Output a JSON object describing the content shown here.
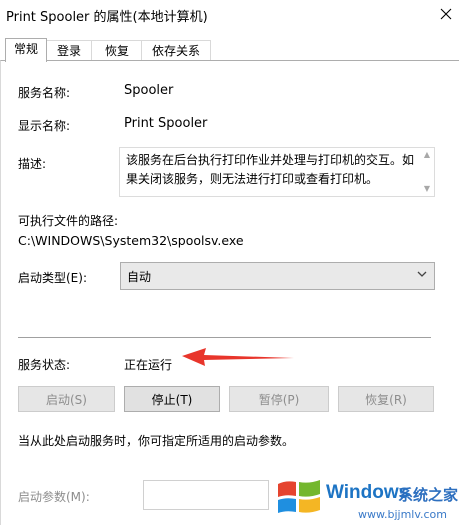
{
  "window": {
    "title": "Print Spooler 的属性(本地计算机)"
  },
  "tabs": [
    {
      "label": "常规"
    },
    {
      "label": "登录"
    },
    {
      "label": "恢复"
    },
    {
      "label": "依存关系"
    }
  ],
  "general": {
    "service_name_label": "服务名称:",
    "service_name_value": "Spooler",
    "display_name_label": "显示名称:",
    "display_name_value": "Print Spooler",
    "description_label": "描述:",
    "description_value": "该服务在后台执行打印作业并处理与打印机的交互。如果关闭该服务，则无法进行打印或查看打印机。",
    "exe_path_label": "可执行文件的路径:",
    "exe_path_value": "C:\\WINDOWS\\System32\\spoolsv.exe",
    "startup_type_label": "启动类型(E):",
    "startup_type_value": "自动",
    "service_status_label": "服务状态:",
    "service_status_value": "正在运行"
  },
  "buttons": {
    "start": "启动(S)",
    "stop": "停止(T)",
    "pause": "暂停(P)",
    "resume": "恢复(R)"
  },
  "hint": "当从此处启动服务时，你可指定所适用的启动参数。",
  "start_params": {
    "label": "启动参数(M):",
    "value": ""
  },
  "watermark": {
    "brand": "Windows",
    "suffix": "系统之家",
    "url": "www.bjjmlv.com"
  },
  "colors": {
    "arrow": "#e8352b",
    "watermark_blue": "#1d74c4"
  }
}
